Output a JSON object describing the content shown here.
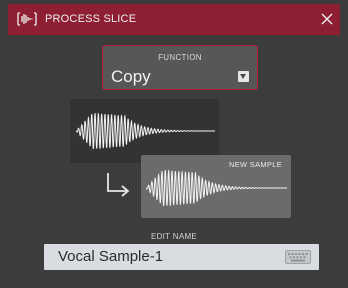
{
  "dialog": {
    "title": "PROCESS SLICE",
    "app_icon": "waveform-bracket-icon",
    "close_icon": "close-icon",
    "accent_color": "#8e1f33"
  },
  "function": {
    "label": "FUNCTION",
    "value": "Copy",
    "dropdown_icon": "chevron-down-icon"
  },
  "preview": {
    "source_icon": "waveform-icon",
    "arrow_icon": "arrow-down-right-icon",
    "new_sample_label": "NEW SAMPLE"
  },
  "edit_name": {
    "label": "EDIT NAME",
    "value": "Vocal Sample-1",
    "keyboard_icon": "keyboard-icon"
  }
}
